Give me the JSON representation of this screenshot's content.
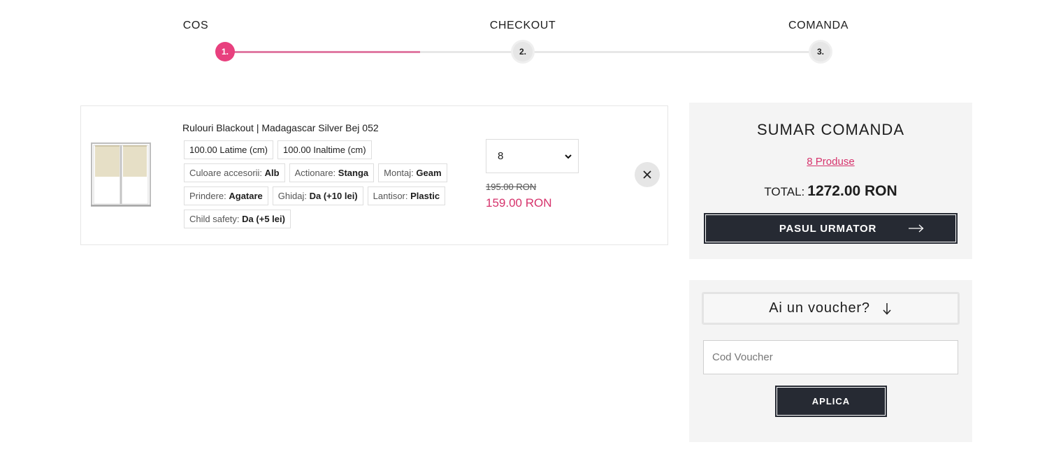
{
  "steps": [
    {
      "label": "COS",
      "number": "1.",
      "state": "active"
    },
    {
      "label": "CHECKOUT",
      "number": "2.",
      "state": "inactive"
    },
    {
      "label": "COMANDA",
      "number": "3.",
      "state": "inactive"
    }
  ],
  "progress": 0.5,
  "colors": {
    "accent": "#e8407e",
    "price": "#d6336c",
    "dark": "#262a33",
    "panel": "#f4f4f4"
  },
  "cart": {
    "item": {
      "name": "Rulouri Blackout | Madagascar Silver Bej 052",
      "image_icon": "window-blind-icon",
      "options": {
        "latime": {
          "value": "100.00",
          "label": "Latime (cm)"
        },
        "inaltime": {
          "value": "100.00",
          "label": "Inaltime (cm)"
        },
        "culoare": {
          "label": "Culoare accesorii:",
          "value": "Alb"
        },
        "actionare": {
          "label": "Actionare:",
          "value": "Stanga"
        },
        "montaj": {
          "label": "Montaj:",
          "value": "Geam"
        },
        "prindere": {
          "label": "Prindere:",
          "value": "Agatare"
        },
        "ghidaj": {
          "label": "Ghidaj:",
          "value": "Da (+10 lei)"
        },
        "lantisor": {
          "label": "Lantisor:",
          "value": "Plastic"
        },
        "child": {
          "label": "Child safety:",
          "value": "Da (+5 lei)"
        }
      },
      "quantity": "8",
      "old_price": "195.00 RON",
      "new_price": "159.00 RON",
      "remove_icon": "close-icon"
    }
  },
  "summary": {
    "title": "SUMAR COMANDA",
    "count": "8 Produse",
    "total_label": "TOTAL:",
    "total_value": "1272.00 RON",
    "next_label": "PASUL URMATOR",
    "next_icon": "arrow-right-icon"
  },
  "voucher": {
    "toggle_label": "Ai un voucher?",
    "toggle_icon": "arrow-down-icon",
    "placeholder": "Cod Voucher",
    "apply_label": "APLICA"
  }
}
